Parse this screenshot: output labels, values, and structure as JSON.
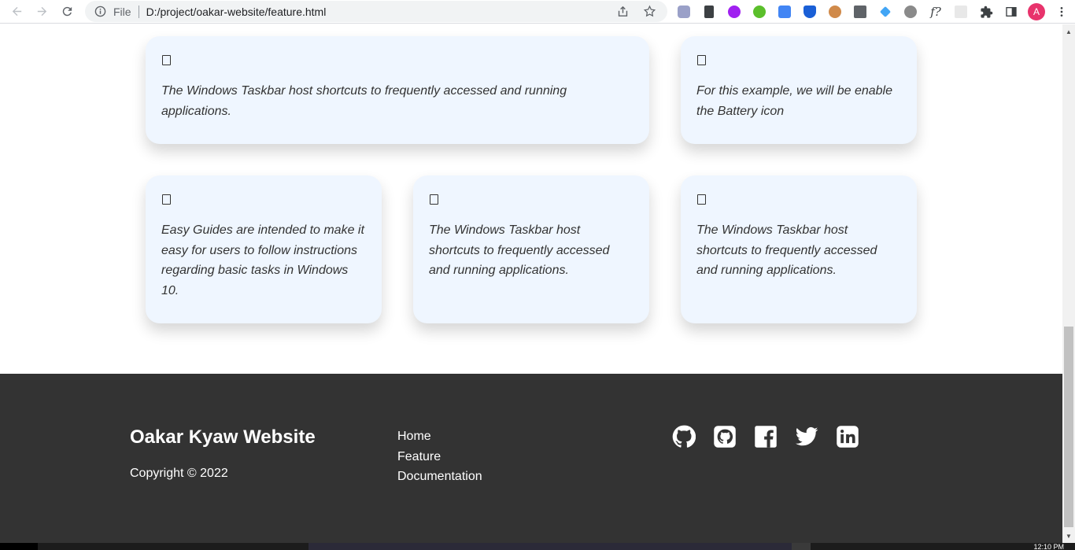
{
  "browser": {
    "scheme_label": "File",
    "url": "D:/project/oakar-website/feature.html",
    "avatar_initial": "A",
    "extensions": [
      {
        "name": "privacy-badger-icon",
        "color": "#9aa0c8"
      },
      {
        "name": "eyedropper-icon",
        "color": "#3c4043"
      },
      {
        "name": "colorzilla-icon",
        "color": "#a020f0"
      },
      {
        "name": "grammar-icon",
        "color": "#5bbf2b"
      },
      {
        "name": "google-translate-icon",
        "color": "#4285f4"
      },
      {
        "name": "bitwarden-shield-icon",
        "color": "#1a5fd6"
      },
      {
        "name": "owl-icon",
        "color": "#d08a4a"
      },
      {
        "name": "image-search-icon",
        "color": "#5f6368"
      },
      {
        "name": "flutter-icon",
        "color": "#42a5f5"
      },
      {
        "name": "bug-icon",
        "color": "#8a8a8a"
      },
      {
        "name": "whatfont-icon",
        "color": "#3c4043"
      },
      {
        "name": "blank-extension-icon",
        "color": "#e0e0e0"
      }
    ]
  },
  "features": {
    "cards": [
      {
        "text": "The Windows Taskbar host shortcuts to frequently accessed and running applications."
      },
      {
        "text": "For this example, we will be enable the Battery icon"
      },
      {
        "text": "Easy Guides are intended to make it easy for users to follow instructions regarding basic tasks in Windows 10."
      },
      {
        "text": "The Windows Taskbar host shortcuts to frequently accessed and running applications."
      },
      {
        "text": "The Windows Taskbar host shortcuts to frequently accessed and running applications."
      }
    ]
  },
  "footer": {
    "brand": "Oakar Kyaw Website",
    "copyright": "Copyright © 2022",
    "links": [
      "Home",
      "Feature",
      "Documentation"
    ],
    "socials": [
      "github-icon",
      "github-square-icon",
      "facebook-icon",
      "twitter-icon",
      "linkedin-icon"
    ]
  },
  "taskbar": {
    "clock": "12:10 PM"
  },
  "colors": {
    "card_bg": "#eff6ff",
    "footer_bg": "#333333",
    "avatar_bg": "#e8336c"
  }
}
